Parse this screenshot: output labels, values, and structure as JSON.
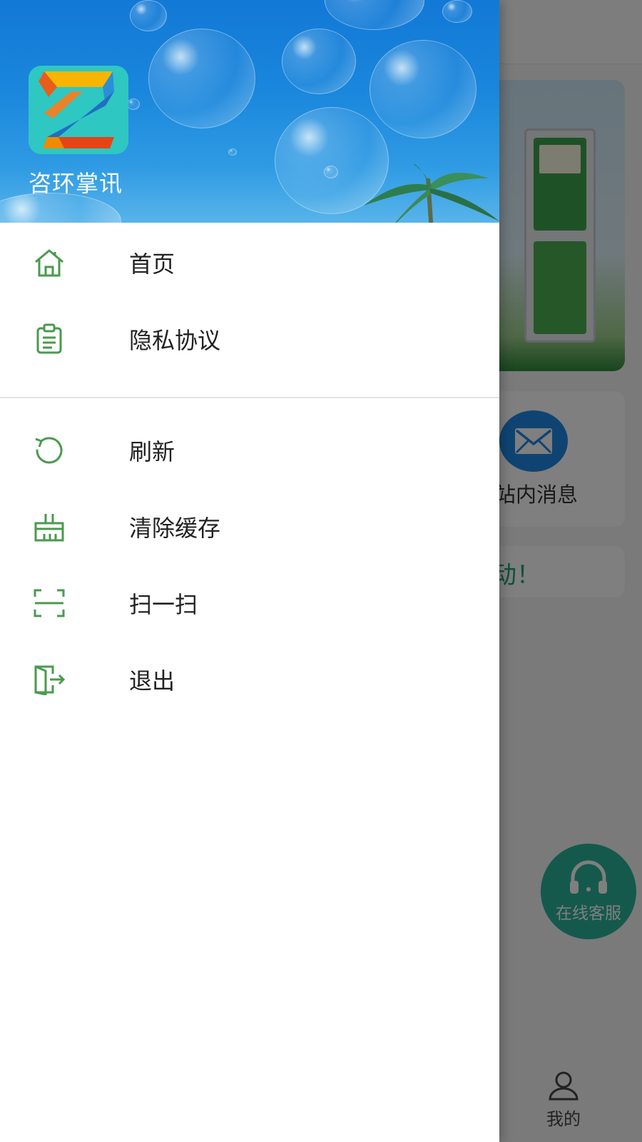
{
  "drawer": {
    "app_name": "咨环掌讯",
    "menu_group_1": [
      {
        "label": "首页",
        "icon": "home-icon"
      },
      {
        "label": "隐私协议",
        "icon": "clipboard-icon"
      }
    ],
    "menu_group_2": [
      {
        "label": "刷新",
        "icon": "refresh-icon"
      },
      {
        "label": "清除缓存",
        "icon": "broom-icon"
      },
      {
        "label": "扫一扫",
        "icon": "scan-icon"
      },
      {
        "label": "退出",
        "icon": "exit-door-icon"
      }
    ]
  },
  "background": {
    "message_label": "站内消息",
    "notice_text": "动！",
    "customer_service_label": "在线客服",
    "tab_mine_label": "我的"
  },
  "colors": {
    "accent_green": "#4a9a4e",
    "header_blue": "#1a86dc",
    "service_teal": "#2bb39a",
    "mail_blue": "#1e88e5"
  }
}
